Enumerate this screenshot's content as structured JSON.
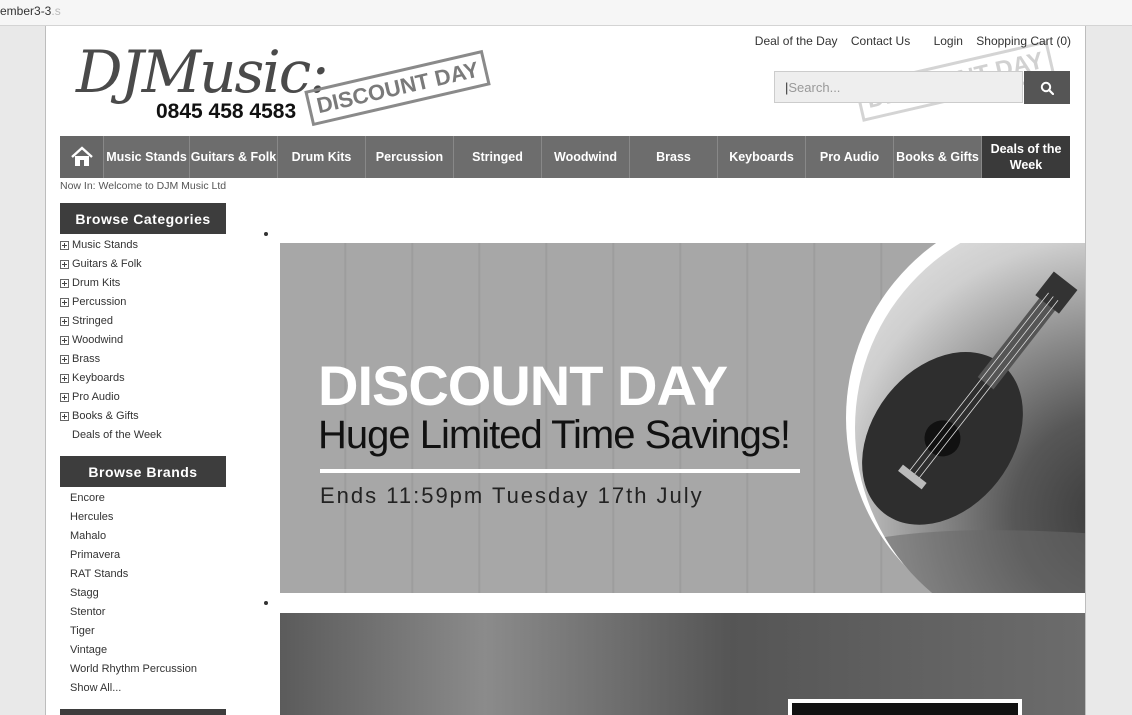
{
  "browser": {
    "tab_text": "ember3-3",
    "tab_fade": ".s"
  },
  "header": {
    "logo_script": "DJMusic:",
    "phone": "0845 458 4583",
    "stamp": "DISCOUNT DAY",
    "links": [
      "Deal of the Day",
      "Contact Us",
      "Login",
      "Shopping Cart (0)"
    ],
    "search_placeholder": "Search..."
  },
  "nav": {
    "items": [
      "Music Stands",
      "Guitars & Folk",
      "Drum Kits",
      "Percussion",
      "Stringed",
      "Woodwind",
      "Brass",
      "Keyboards",
      "Pro Audio",
      "Books & Gifts"
    ],
    "deals_line1": "Deals of the",
    "deals_line2": "Week"
  },
  "breadcrumb": "Now In: Welcome to DJM Music Ltd",
  "sidebar": {
    "categories_title": "Browse Categories",
    "categories": [
      "Music Stands",
      "Guitars & Folk",
      "Drum Kits",
      "Percussion",
      "Stringed",
      "Woodwind",
      "Brass",
      "Keyboards",
      "Pro Audio",
      "Books & Gifts"
    ],
    "deals_link": "Deals of the Week",
    "brands_title": "Browse Brands",
    "brands": [
      "Encore",
      "Hercules",
      "Mahalo",
      "Primavera",
      "RAT Stands",
      "Stagg",
      "Stentor",
      "Tiger",
      "Vintage",
      "World Rhythm Percussion",
      "Show All..."
    ]
  },
  "banner": {
    "title": "DISCOUNT DAY",
    "subtitle": "Huge Limited Time Savings!",
    "ends": "Ends 11:59pm Tuesday 17th July"
  }
}
